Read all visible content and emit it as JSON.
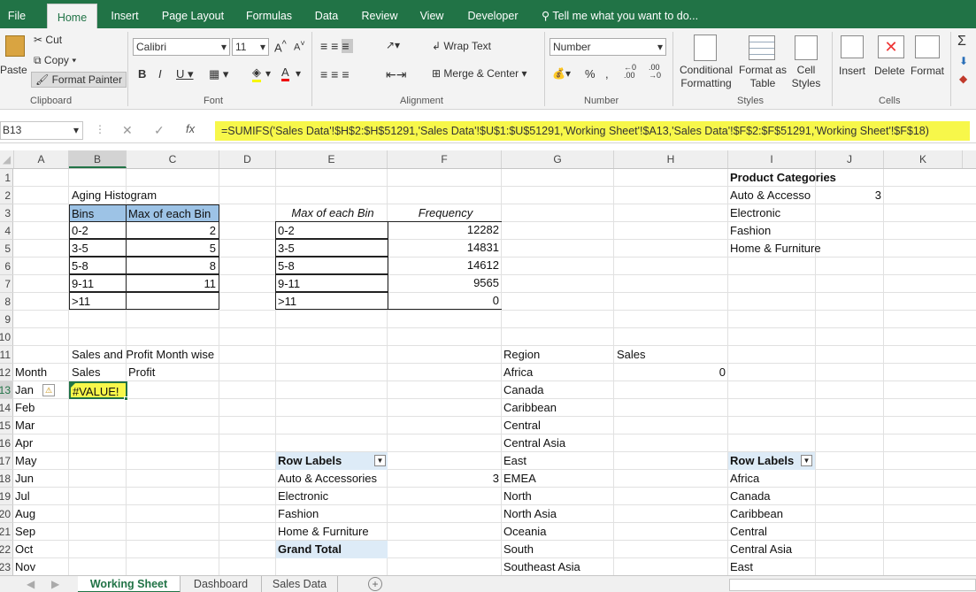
{
  "ribbon_tabs": [
    "File",
    "Home",
    "Insert",
    "Page Layout",
    "Formulas",
    "Data",
    "Review",
    "View",
    "Developer"
  ],
  "tell_me": "Tell me what you want to do...",
  "clipboard": {
    "paste": "Paste",
    "cut": "Cut",
    "copy": "Copy",
    "format_painter": "Format Painter",
    "group": "Clipboard"
  },
  "font": {
    "name": "Calibri",
    "size": "11",
    "group": "Font"
  },
  "alignment": {
    "wrap": "Wrap Text",
    "merge": "Merge & Center",
    "group": "Alignment"
  },
  "number": {
    "format": "Number",
    "group": "Number"
  },
  "styles": {
    "conditional": "Conditional Formatting",
    "format_table": "Format as Table",
    "cell_styles": "Cell Styles",
    "group": "Styles"
  },
  "cells": {
    "insert": "Insert",
    "delete": "Delete",
    "format": "Format",
    "group": "Cells"
  },
  "name_box": "B13",
  "formula": "=SUMIFS('Sales Data'!$H$2:$H$51291,'Sales Data'!$U$1:$U$51291,'Working Sheet'!$A13,'Sales Data'!$F$2:$F$51291,'Working Sheet'!$F$18)",
  "columns": [
    "A",
    "B",
    "C",
    "D",
    "E",
    "F",
    "G",
    "H",
    "I",
    "J",
    "K"
  ],
  "rows": [
    "1",
    "2",
    "3",
    "4",
    "5",
    "6",
    "7",
    "8",
    "9",
    "10",
    "11",
    "12",
    "13",
    "14",
    "15",
    "16",
    "17",
    "18",
    "19",
    "20",
    "21",
    "22",
    "23"
  ],
  "aging": {
    "title": "Aging Histogram",
    "h1": "Bins",
    "h2": "Max of each Bin",
    "bins": [
      "0-2",
      "3-5",
      "5-8",
      "9-11",
      ">11"
    ],
    "maxes": [
      "2",
      "5",
      "8",
      "11",
      ""
    ]
  },
  "freq": {
    "h1": "Max of each Bin",
    "h2": "Frequency",
    "bins": [
      "0-2",
      "3-5",
      "5-8",
      "9-11",
      ">11"
    ],
    "values": [
      "12282",
      "14831",
      "14612",
      "9565",
      "0"
    ]
  },
  "products": {
    "title": "Product Categories",
    "items": [
      "Auto & Accesso",
      "Electronic",
      "Fashion",
      "Home & Furniture"
    ],
    "j2": "3"
  },
  "sp": {
    "title": "Sales and Profit Month wise",
    "month": "Month",
    "sales": "Sales",
    "profit": "Profit",
    "error": "#VALUE!",
    "months": [
      "Jan",
      "Feb",
      "Mar",
      "Apr",
      "May",
      "Jun",
      "Jul",
      "Aug",
      "Sep",
      "Oct",
      "Nov"
    ]
  },
  "region": {
    "title": "Region",
    "sales": "Sales",
    "h12": "0",
    "list": [
      "Africa",
      "Canada",
      "Caribbean",
      "Central",
      "Central Asia",
      "East",
      "EMEA",
      "North",
      "North Asia",
      "Oceania",
      "South",
      "Southeast Asia"
    ]
  },
  "pivot1": {
    "label": "Row Labels",
    "items": [
      "Auto & Accessories",
      "Electronic",
      "Fashion",
      "Home & Furniture"
    ],
    "total": "Grand Total",
    "f18": "3"
  },
  "pivot2": {
    "label": "Row Labels",
    "items": [
      "Africa",
      "Canada",
      "Caribbean",
      "Central",
      "Central Asia",
      "East"
    ]
  },
  "sheets": [
    "Working Sheet",
    "Dashboard",
    "Sales Data"
  ]
}
